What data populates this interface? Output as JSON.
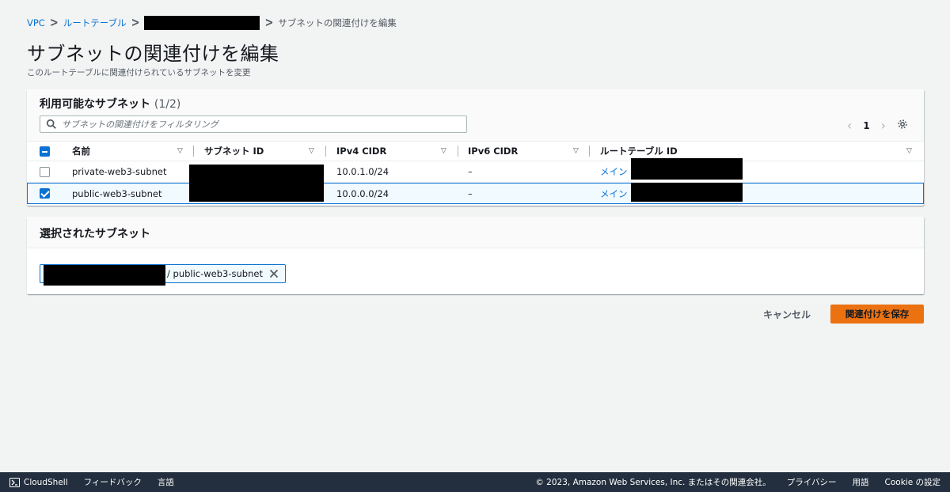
{
  "breadcrumb": {
    "root": "VPC",
    "parent": "ルートテーブル",
    "current": "サブネットの関連付けを編集"
  },
  "page": {
    "title": "サブネットの関連付けを編集",
    "description": "このルートテーブルに関連付けられているサブネットを変更"
  },
  "available": {
    "title": "利用可能なサブネット",
    "count": "(1/2)",
    "filter_placeholder": "サブネットの関連付けをフィルタリング",
    "page": "1",
    "columns": [
      "名前",
      "サブネット ID",
      "IPv4 CIDR",
      "IPv6 CIDR",
      "ルートテーブル ID"
    ],
    "rows": [
      {
        "name": "private-web3-subnet",
        "ipv4": "10.0.1.0/24",
        "ipv6": "–",
        "route": "メイン",
        "selected": false
      },
      {
        "name": "public-web3-subnet",
        "ipv4": "10.0.0.0/24",
        "ipv6": "–",
        "route": "メイン",
        "selected": true
      }
    ]
  },
  "selected": {
    "title": "選択されたサブネット",
    "token_label": "/ public-web3-subnet"
  },
  "actions": {
    "cancel": "キャンセル",
    "save": "関連付けを保存"
  },
  "footer": {
    "cloudshell": "CloudShell",
    "feedback": "フィードバック",
    "language": "言語",
    "copyright": "© 2023, Amazon Web Services, Inc. またはその関連会社。",
    "privacy": "プライバシー",
    "terms": "用語",
    "cookie": "Cookie の設定"
  },
  "colors": {
    "link": "#0972d3",
    "primary_button": "#ec7211",
    "footer_bg": "#232f3e",
    "selected_row_bg": "#f1faff"
  }
}
